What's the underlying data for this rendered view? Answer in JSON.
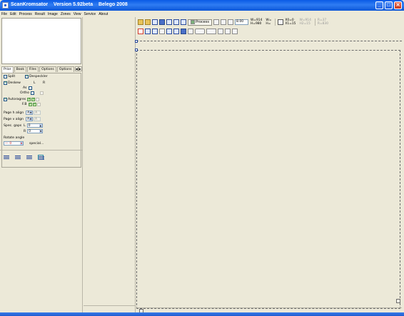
{
  "window": {
    "title": "ScanKromsator    Version 5.92beta    Belego 2008",
    "minimize": "_",
    "maximize": "□",
    "close": "✕"
  },
  "menu": [
    "File",
    "Edit",
    "Process",
    "Result",
    "Image",
    "Zones",
    "View",
    "Service",
    "About"
  ],
  "left_panel": {
    "tabs": [
      "Prior",
      "Book",
      "Files",
      "Options",
      "Options"
    ],
    "active_tab": "Prior",
    "tab_arrows": [
      "◀",
      "▶"
    ],
    "split_label": "Split",
    "despeckler_label": "Despeckler",
    "deskew_label": "Deskew",
    "col_L": "L",
    "col_R": "R",
    "as_label": "As",
    "ortho_label": "Ortho",
    "autoragres_label": "Autoragres",
    "fb_label": "F.B",
    "page_h_align_label": "Page h align",
    "page_v_align_label": "Page v align",
    "align_value": "A",
    "spec_gaps_label": "Spec. gaps",
    "gaps_L_label": "L",
    "gaps_L_value": "0",
    "gaps_R_label": "R",
    "gaps_R_value": "0",
    "rotate_angle_label": "Rotate angle",
    "rotate_value": "0",
    "special_label": "special..."
  },
  "toolbar": {
    "process_label": "Process",
    "value_field": "8.00",
    "readouts_1": [
      "W=914",
      "H=980"
    ],
    "readouts_2": [
      "W=",
      "H="
    ],
    "readouts_3": [
      "X0=0",
      "X1=15"
    ],
    "readouts_4": [
      "W=914",
      "H2=15"
    ],
    "readouts_5": [
      "R=37",
      "R=830"
    ]
  },
  "colors": {
    "titlebar": "#0a5ae6",
    "window_bg": "#ece9d8",
    "canvas_border": "#6b6b6b",
    "check_green": "#21a121"
  }
}
